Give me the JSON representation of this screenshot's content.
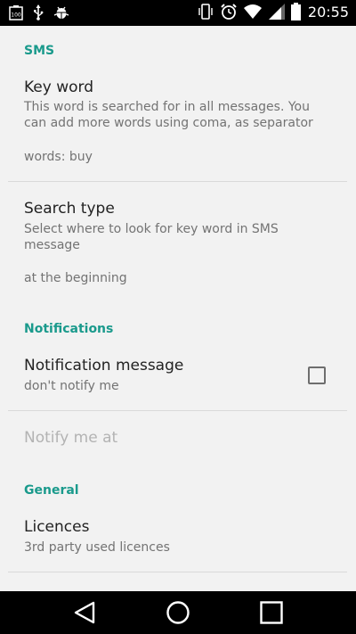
{
  "status_bar": {
    "time": "20:55",
    "battery_level_label": "100",
    "icons": [
      "battery-full-notification-icon",
      "usb-icon",
      "android-debug-icon",
      "vibrate-icon",
      "alarm-icon",
      "wifi-icon",
      "signal-icon",
      "battery-icon"
    ]
  },
  "settings": {
    "sms_header": "SMS",
    "key_word": {
      "title": "Key word",
      "summary": "This word is searched for in all messages. You can add more words using coma, as separator",
      "value": "words: buy"
    },
    "search_type": {
      "title": "Search type",
      "summary": "Select where to look for key word in SMS message",
      "value": "at the beginning"
    },
    "notifications_header": "Notifications",
    "notification_message": {
      "title": "Notification message",
      "summary": "don't notify me",
      "checked": false
    },
    "notify_me_at": {
      "title": "Notify me at",
      "enabled": false
    },
    "general_header": "General",
    "licences": {
      "title": "Licences",
      "summary": "3rd party used licences"
    }
  },
  "nav_bar": {
    "buttons": [
      "back",
      "home",
      "recents"
    ]
  },
  "colors": {
    "accent": "#1a9a8c",
    "background": "#f2f2f2",
    "bars": "#000000"
  }
}
